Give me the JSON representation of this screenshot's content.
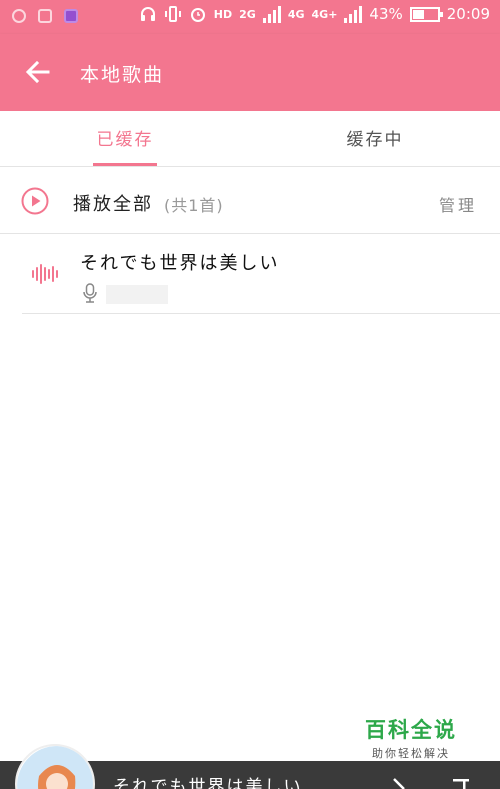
{
  "status_bar": {
    "network_label_1": "HD",
    "network_label_2": "2G",
    "network_label_3": "4G",
    "network_label_4": "4G+",
    "battery_text": "43%",
    "battery_level": 0.43,
    "time": "20:09"
  },
  "header": {
    "title": "本地歌曲"
  },
  "tabs": [
    {
      "label": "已缓存",
      "active": true
    },
    {
      "label": "缓存中",
      "active": false
    }
  ],
  "play_all": {
    "label": "播放全部",
    "count": "(共1首)",
    "manage": "管理"
  },
  "songs": [
    {
      "title": "それでも世界は美しい",
      "singer": ""
    }
  ],
  "watermark": {
    "title": "百科全说",
    "subtitle": "助你轻松解决"
  },
  "player": {
    "song_title": "それでも世界は美しい"
  },
  "colors": {
    "accent": "#f3768f",
    "watermark_green": "#2da84a"
  }
}
